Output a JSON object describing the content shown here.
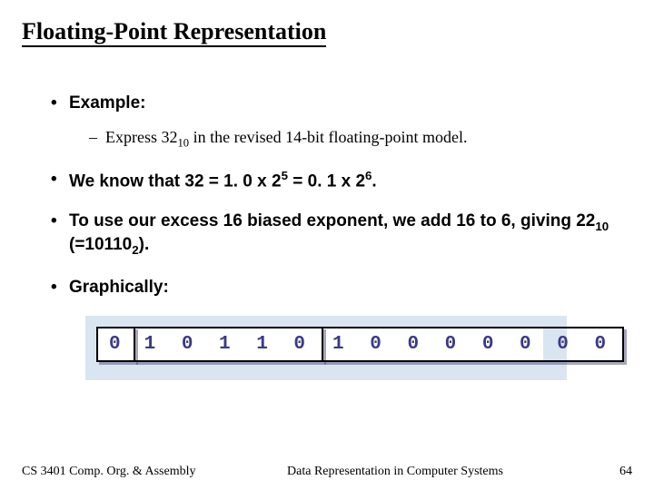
{
  "title": "Floating-Point Representation",
  "bullets": {
    "b1": "Example:",
    "b1_sub_pre": "Express 32",
    "b1_sub_sub": "10",
    "b1_sub_post": " in the revised 14-bit floating-point model.",
    "b2_pre": "We know that 32 = 1. 0 x 2",
    "b2_sup1": "5",
    "b2_mid": " = 0. 1 x 2",
    "b2_sup2": "6",
    "b2_post": ".",
    "b3_pre": "To use our excess 16 biased exponent, we add 16 to 6, giving 22",
    "b3_sub1": "10",
    "b3_mid": " (=10110",
    "b3_sub2": "2",
    "b3_post": ").",
    "b4": "Graphically:"
  },
  "bits": {
    "sign": "0",
    "exponent": "1 0 1 1 0",
    "mantissa": "1 0 0 0 0 0 0 0"
  },
  "footer": {
    "left": "CS 3401 Comp. Org. & Assembly",
    "center": "Data Representation in Computer Systems",
    "page": "64"
  }
}
